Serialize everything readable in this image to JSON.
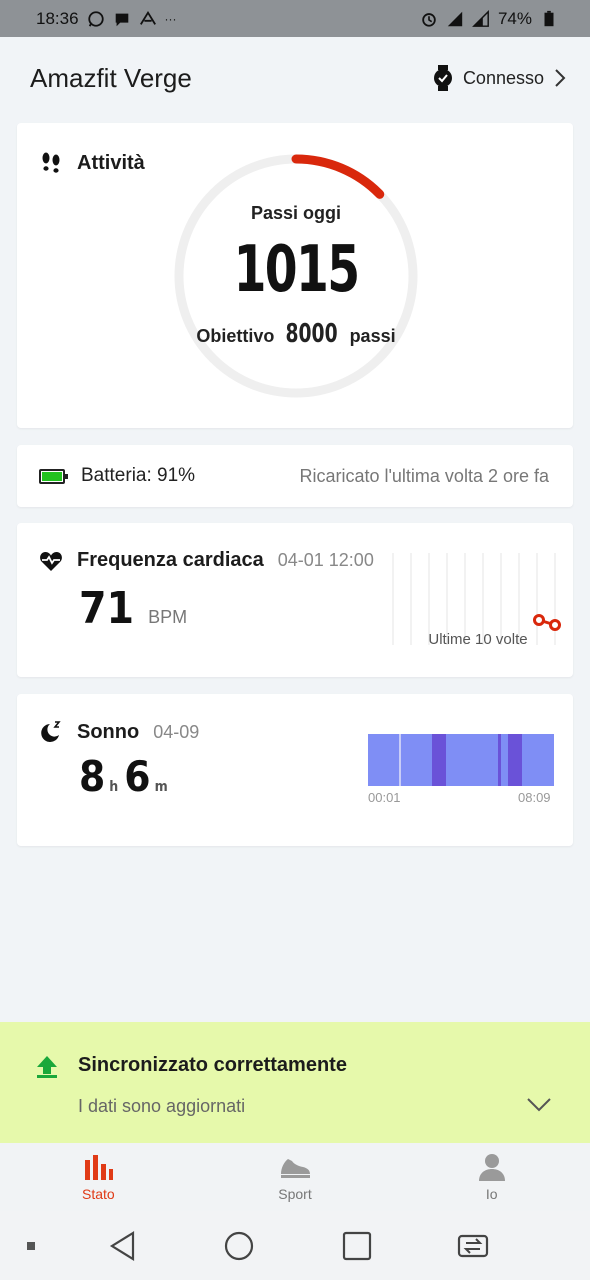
{
  "status_bar": {
    "time": "18:36",
    "battery": "74%"
  },
  "header": {
    "title": "Amazfit Verge",
    "connection": "Connesso"
  },
  "activity": {
    "title": "Attività",
    "steps_label": "Passi oggi",
    "steps_value": "1015",
    "goal_prefix": "Obiettivo",
    "goal_value": "8000",
    "goal_suffix": "passi",
    "progress_fraction": 0.127,
    "ring_color": "#d9280c"
  },
  "battery": {
    "label": "Batteria: 91%",
    "level_fraction": 0.91,
    "note": "Ricaricato l'ultima volta 2 ore fa",
    "color": "#22c21f"
  },
  "heart": {
    "title": "Frequenza cardiaca",
    "timestamp": "04-01 12:00",
    "value": "71",
    "unit": "BPM",
    "chart_caption": "Ultime 10 volte",
    "accent": "#d9280c"
  },
  "sleep": {
    "title": "Sonno",
    "date": "04-09",
    "hours": "8",
    "hours_unit": "h",
    "minutes": "6",
    "minutes_unit": "m",
    "start_time": "00:01",
    "end_time": "08:09",
    "light_color": "#7f8ef5",
    "deep_color": "#6a52d8"
  },
  "sync": {
    "title": "Sincronizzato correttamente",
    "subtitle": "I dati sono aggiornati",
    "icon_color": "#1aa83a"
  },
  "tabs": [
    {
      "label": "Stato",
      "icon": "bar-chart-icon",
      "active": true
    },
    {
      "label": "Sport",
      "icon": "shoe-icon",
      "active": false
    },
    {
      "label": "Io",
      "icon": "person-icon",
      "active": false
    }
  ]
}
